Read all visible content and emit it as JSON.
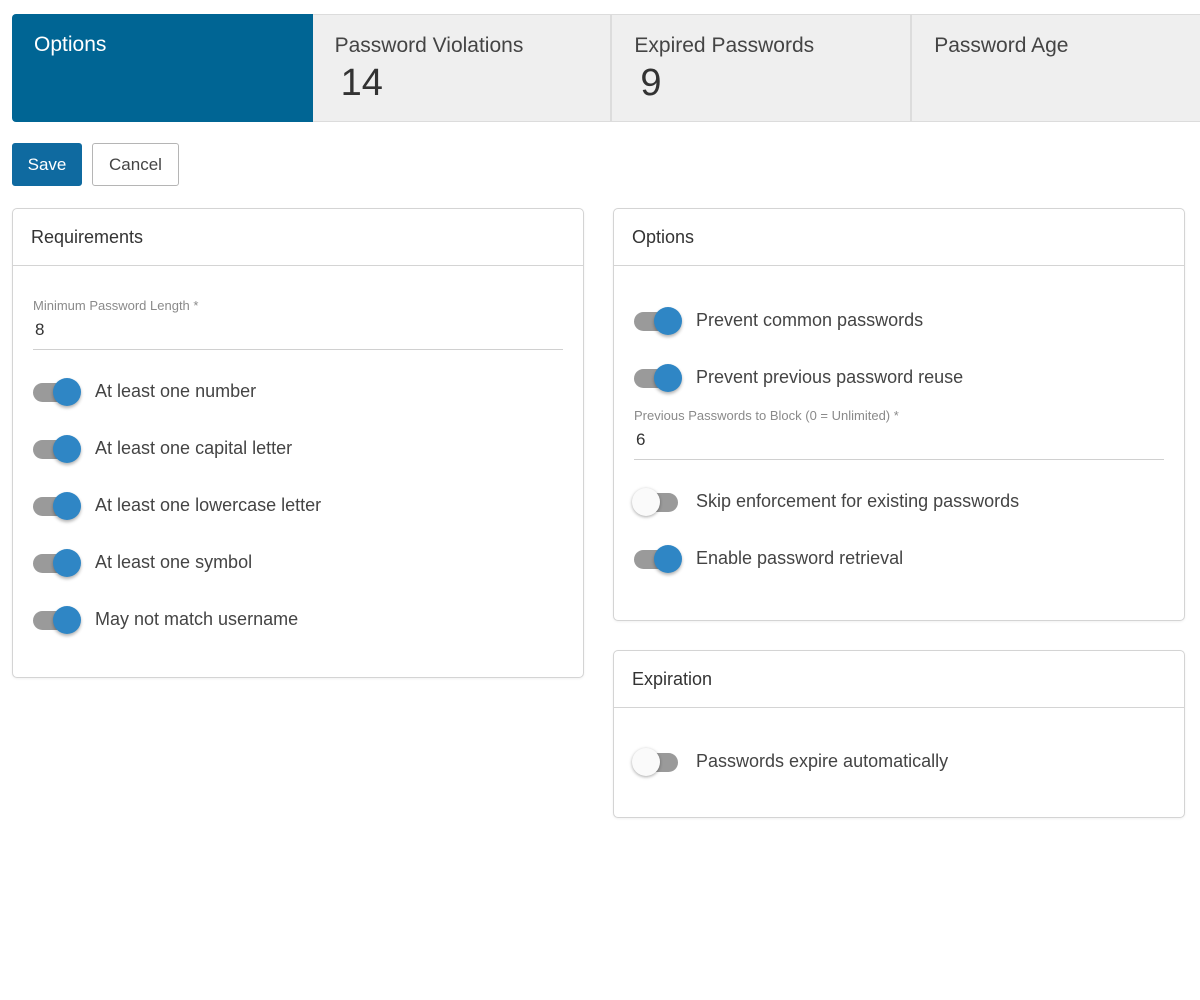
{
  "tabs": [
    {
      "label": "Options",
      "count": null,
      "active": true
    },
    {
      "label": "Password Violations",
      "count": "14",
      "active": false
    },
    {
      "label": "Expired Passwords",
      "count": "9",
      "active": false
    },
    {
      "label": "Password Age",
      "count": null,
      "active": false
    }
  ],
  "actions": {
    "save_label": "Save",
    "cancel_label": "Cancel"
  },
  "colors": {
    "accent": "#006594",
    "primary_button": "#0f6aa0",
    "toggle_on": "#2f86c5",
    "toggle_track": "#9a9a9a"
  },
  "requirements": {
    "title": "Requirements",
    "min_length": {
      "label": "Minimum Password Length *",
      "value": "8"
    },
    "toggles": [
      {
        "label": "At least one number",
        "on": true
      },
      {
        "label": "At least one capital letter",
        "on": true
      },
      {
        "label": "At least one lowercase letter",
        "on": true
      },
      {
        "label": "At least one symbol",
        "on": true
      },
      {
        "label": "May not match username",
        "on": true
      }
    ]
  },
  "options": {
    "title": "Options",
    "toggles": [
      {
        "label": "Prevent common passwords",
        "on": true
      },
      {
        "label": "Prevent previous password reuse",
        "on": true
      },
      {
        "label": "Skip enforcement for existing passwords",
        "on": false
      },
      {
        "label": "Enable password retrieval",
        "on": true
      }
    ],
    "previous_block": {
      "label": "Previous Passwords to Block (0 = Unlimited) *",
      "value": "6"
    }
  },
  "expiration": {
    "title": "Expiration",
    "toggles": [
      {
        "label": "Passwords expire automatically",
        "on": false
      }
    ]
  }
}
